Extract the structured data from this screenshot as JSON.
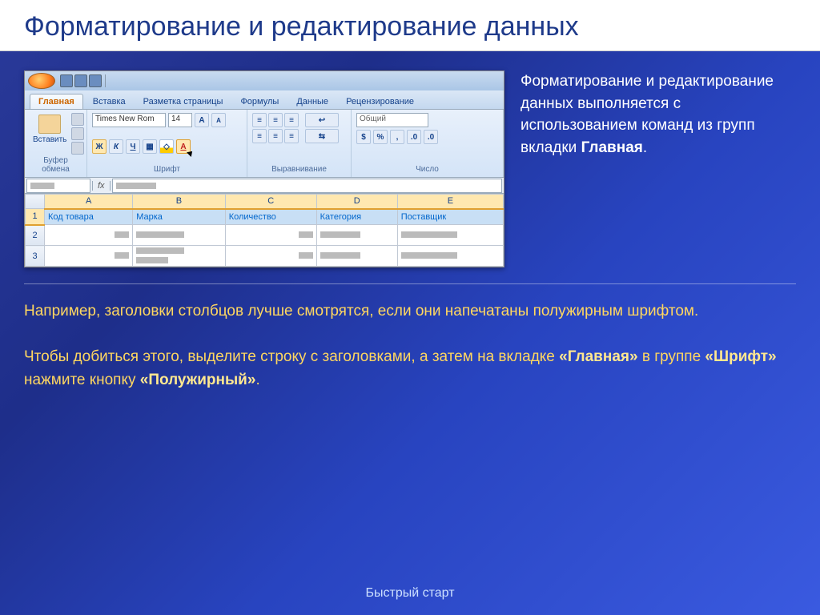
{
  "title": "Форматирование и редактирование данных",
  "side_paragraph": "Форматирование и редактирование данных выполняется с использованием команд из групп вкладки ",
  "side_bold": "Главная",
  "side_period": ".",
  "bottom_p1": "Например, заголовки столбцов лучше смотрятся, если они напечатаны полужирным шрифтом.",
  "bottom_p2_a": "Чтобы добиться этого, выделите строку с заголовками, а затем на вкладке ",
  "bottom_p2_b1": "«Главная»",
  "bottom_p2_c": " в группе ",
  "bottom_p2_b2": "«Шрифт»",
  "bottom_p2_d": " нажмите кнопку ",
  "bottom_p2_b3": "«Полужирный»",
  "bottom_p2_e": ".",
  "footer": "Быстрый старт",
  "tabs": [
    "Главная",
    "Вставка",
    "Разметка страницы",
    "Формулы",
    "Данные",
    "Рецензирование"
  ],
  "ribbon": {
    "paste": "Вставить",
    "group_clipboard": "Буфер обмена",
    "font_name": "Times New Rom",
    "font_size": "14",
    "group_font": "Шрифт",
    "group_align": "Выравнивание",
    "number_format": "Общий",
    "group_number": "Число",
    "bold": "Ж",
    "italic": "К",
    "underline": "Ч"
  },
  "columns": [
    "A",
    "B",
    "C",
    "D",
    "E"
  ],
  "headers": [
    "Код товара",
    "Марка",
    "Количество",
    "Категория",
    "Поставщик"
  ],
  "rownums": [
    "1",
    "2",
    "3"
  ],
  "fx": "fx"
}
